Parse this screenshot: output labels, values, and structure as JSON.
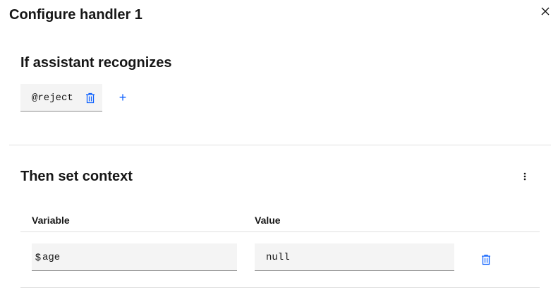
{
  "modal": {
    "title": "Configure handler 1"
  },
  "recognize_section": {
    "title": "If assistant recognizes",
    "tags": [
      {
        "label": "@reject"
      }
    ],
    "add_label": "+"
  },
  "context_section": {
    "title": "Then set context",
    "columns": {
      "variable": "Variable",
      "value": "Value"
    },
    "rows": [
      {
        "prefix": "$",
        "variable": "age",
        "value": "null"
      }
    ]
  },
  "colors": {
    "accent": "#0f62fe",
    "field_bg": "#f4f4f4",
    "divider": "#e0e0e0",
    "text": "#161616"
  },
  "icons": {
    "close": "close-icon",
    "trash": "trash-icon",
    "add": "add-icon",
    "overflow": "overflow-menu-icon"
  }
}
